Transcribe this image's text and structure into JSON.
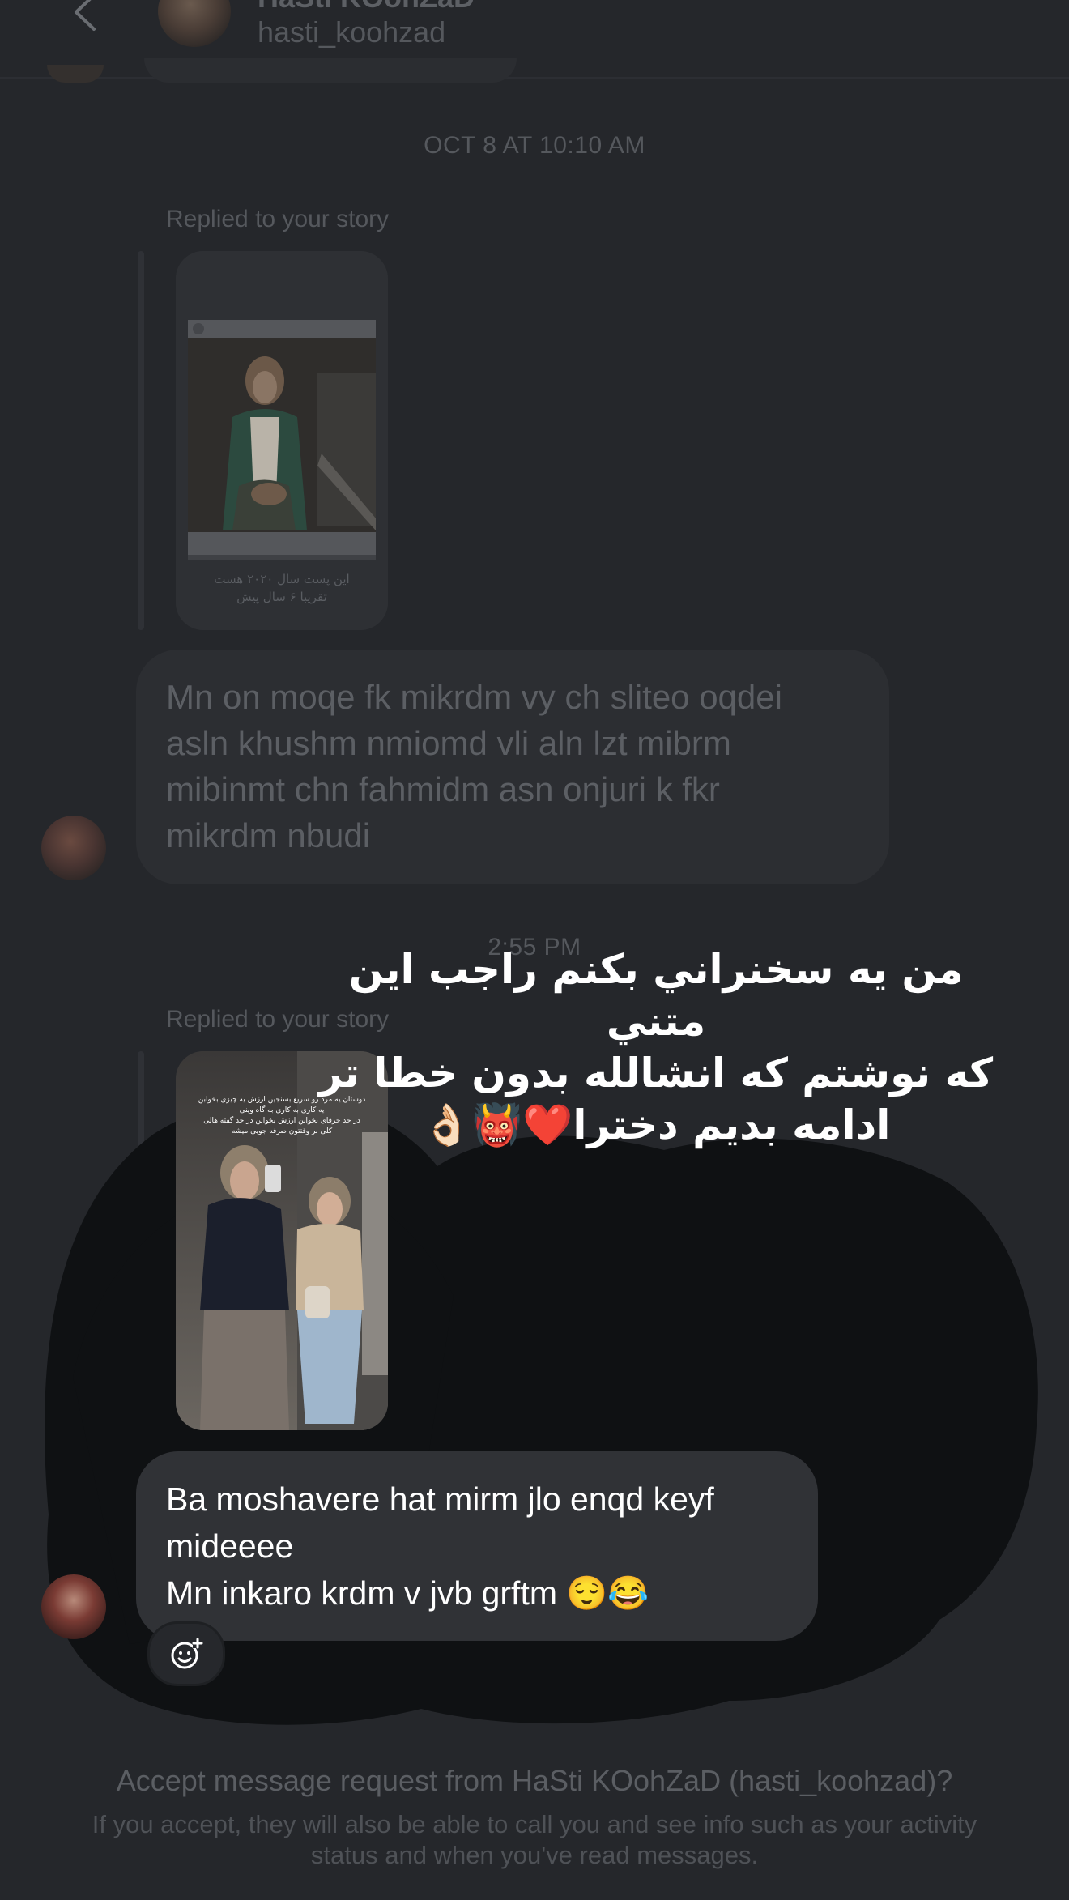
{
  "header": {
    "title": "HaSti  KOohZaD",
    "username": "hasti_koohzad"
  },
  "thread": {
    "timestamp_1": "OCT 8 AT 10:10 AM",
    "reply_label_1": "Replied to your story",
    "story_1_caption": "این پست سال ۲۰۲۰ هست\nتقریبا ۶ سال پیش",
    "message_1": "Mn on moqe fk mikrdm vy ch sliteo oqdei\nasln khushm nmiomd vli aln lzt mibrm\nmibinmt chn fahmidm asn onjuri k fkr\nmikrdm nbudi",
    "timestamp_2": "2:55 PM",
    "reply_label_2": "Replied to your story",
    "story_2_caption": "دوستان یه مرد رو سریع بسنجین ارزش یه چیزی بخوابن یه کاری به کاری به گاه وینی\nدر حد حرفای بخوابن ارزش بخوابن در حد گفته هالی\nکلی بر وقتتون صرفه جویی میشه",
    "message_2": "Ba moshavere hat mirm jlo enqd keyf\nmideeee\nMn inkaro krdm v  jvb grftm 😌😂"
  },
  "overlay": {
    "caption": "من یه سخنراني بكنم راجب اين متني\nكه نوشتم كه انشالله بدون خطا تر\nادامه بديم دخترا❤️👹👌🏻"
  },
  "footer": {
    "accept_title": "Accept message request from HaSti  KOohZaD (hasti_koohzad)?",
    "accept_subtitle": "If you accept, they will also be able to call you and see info such as your activity status and when you've read messages."
  },
  "icons": {
    "back": "chevron-left-icon",
    "react": "add-reaction-icon"
  },
  "colors": {
    "background": "#25272b",
    "bubble": "#303236",
    "scribble": "#0f1113"
  }
}
